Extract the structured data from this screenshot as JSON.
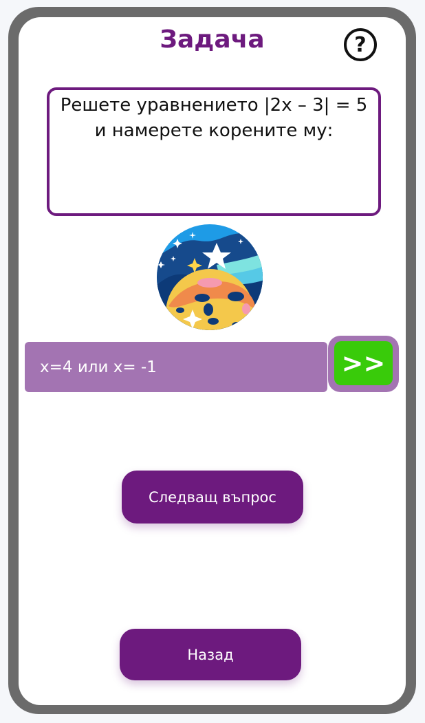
{
  "header": {
    "title": "Задача",
    "help_label": "?"
  },
  "question": {
    "line1": "Решете уравнението |2x – 3| = 5",
    "line2": "и намерете корените му:"
  },
  "answer": {
    "value": "x=4 или x= -1",
    "submit_label": ">>"
  },
  "buttons": {
    "next_label": "Следващ въпрос",
    "back_label": "Назад"
  },
  "colors": {
    "accent": "#6d1a7e",
    "input_bg": "#a374b2",
    "submit": "#39cb0a",
    "frame": "#6b6b6b"
  }
}
